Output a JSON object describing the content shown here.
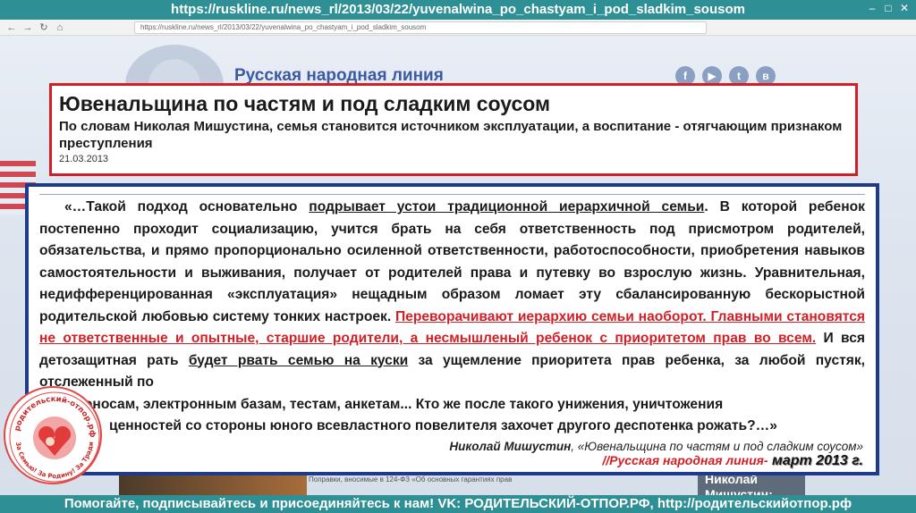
{
  "top_url": "https://ruskline.ru/news_rl/2013/03/22/yuvenalwina_po_chastyam_i_pod_sladkim_sousom",
  "browser": {
    "url": "https://ruskline.ru/news_rl/2013/03/22/yuvenalwina_po_chastyam_i_pod_sladkim_sousom"
  },
  "site": {
    "name": "Русская народная линия"
  },
  "article": {
    "title": "Ювенальщина по частям и под сладким соусом",
    "subtitle": "По словам Николая Мишустина, семья становится источником эксплуатации, а воспитание - отягчающим признаком преступления",
    "date": "21.03.2013"
  },
  "quote": {
    "p1_a": "«…Такой подход основательно ",
    "p1_u": "подрывает устои традиционной иерархичной семьи",
    "p1_b": ". В которой ребенок постепенно проходит социализацию, учится брать на себя ответственность под присмотром родителей, обязательства, и прямо пропорционально осиленной ответственности, работоспособности, приобретения навыков самостоятельности и выживания, получает от родителей права и путевку во взрослую жизнь. Уравнительная, недифференцированная «эксплуатация» нещадным образом ломает эту сбалансированную бескорыстной родительской любовью систему тонких настроек. ",
    "red": "Переворачивают иерархию семьи наоборот. Главными становятся не ответственные и опытные, старшие родители, а несмышленый ребенок с приоритетом прав во всем.",
    "p2_a": " И вся детозащитная рать ",
    "p2_u": "будет рвать семью на куски",
    "p2_b": " за ущемление приоритета прав ребенка, за любой пустяк, отслеженный по",
    "line_indent": "доносам, электронным базам, тестам, анкетам... Кто же после такого унижения, уничтожения",
    "line_last": "ценностей со стороны юного всевластного повелителя захочет другого деспотенка рожать?…»",
    "attribution_author": "Николай Мишустин",
    "attribution_work": ", «Ювенальщина по частям и под сладким соусом»",
    "source_prefix": "//Русская народная линия-",
    "source_date": " март 2013 г."
  },
  "stamp": {
    "text_top": "родительский-отпор.рф",
    "text_bottom": "За Семью! За Родину! За Традиции!"
  },
  "behind": {
    "text": "Поправки, вносимые в 124-ФЗ «Об основных гарантиях прав",
    "right": "Николай Мишустин:"
  },
  "bottom_banner": "Помогайте, подписывайтесь и присоединяйтесь к нам! VK: РОДИТЕЛЬСКИЙ-ОТПОР.РФ, http://родительскийотпор.рф",
  "colors": {
    "teal": "#2e8f94",
    "red": "#d11f25",
    "navy": "#1e3a8a"
  }
}
